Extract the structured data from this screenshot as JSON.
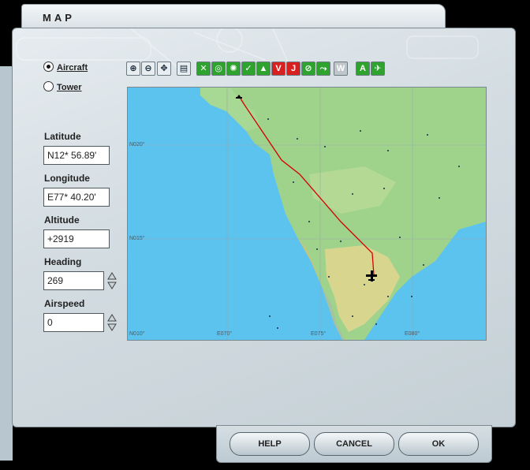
{
  "window": {
    "title": "MAP"
  },
  "view_mode": {
    "aircraft_label": "Aircraft",
    "tower_label": "Tower",
    "selected": "Aircraft"
  },
  "fields": {
    "latitude": {
      "label": "Latitude",
      "value": "N12* 56.89'"
    },
    "longitude": {
      "label": "Longitude",
      "value": "E77* 40.20'"
    },
    "altitude": {
      "label": "Altitude",
      "value": "+2919"
    },
    "heading": {
      "label": "Heading",
      "value": "269"
    },
    "airspeed": {
      "label": "Airspeed",
      "value": "0"
    }
  },
  "toolbar": {
    "tools": [
      {
        "icon": "zoom-in-icon"
      },
      {
        "icon": "zoom-out-icon"
      },
      {
        "icon": "center-icon"
      },
      {
        "icon": "print-icon"
      },
      {
        "icon": "airports-icon",
        "color": "#2ea32e"
      },
      {
        "icon": "vor-icon",
        "color": "#2ea32e"
      },
      {
        "icon": "ndb-icon",
        "color": "#2ea32e"
      },
      {
        "icon": "ils-icon",
        "color": "#2ea32e"
      },
      {
        "icon": "intersections-icon",
        "color": "#2ea32e"
      },
      {
        "icon": "victor-airways-icon",
        "color": "#d92020"
      },
      {
        "icon": "jet-airways-icon",
        "color": "#d92020"
      },
      {
        "icon": "airspace-icon",
        "color": "#2ea32e"
      },
      {
        "icon": "route-icon",
        "color": "#2ea32e"
      },
      {
        "icon": "weather-icon",
        "color": "#bfc6ca",
        "disabled": true
      },
      {
        "icon": "labels-icon",
        "color": "#2ea32e"
      },
      {
        "icon": "traffic-icon",
        "color": "#2ea32e"
      }
    ]
  },
  "map": {
    "lat_labels": [
      "N020°",
      "N015°",
      "N010°"
    ],
    "lon_labels": [
      "E070°",
      "E075°",
      "E080°"
    ],
    "colors": {
      "ocean": "#5cc3ee",
      "land": "#9fd38c",
      "highland": "#e6d78e",
      "route": "#d40000"
    }
  },
  "buttons": {
    "help": "HELP",
    "cancel": "CANCEL",
    "ok": "OK"
  }
}
